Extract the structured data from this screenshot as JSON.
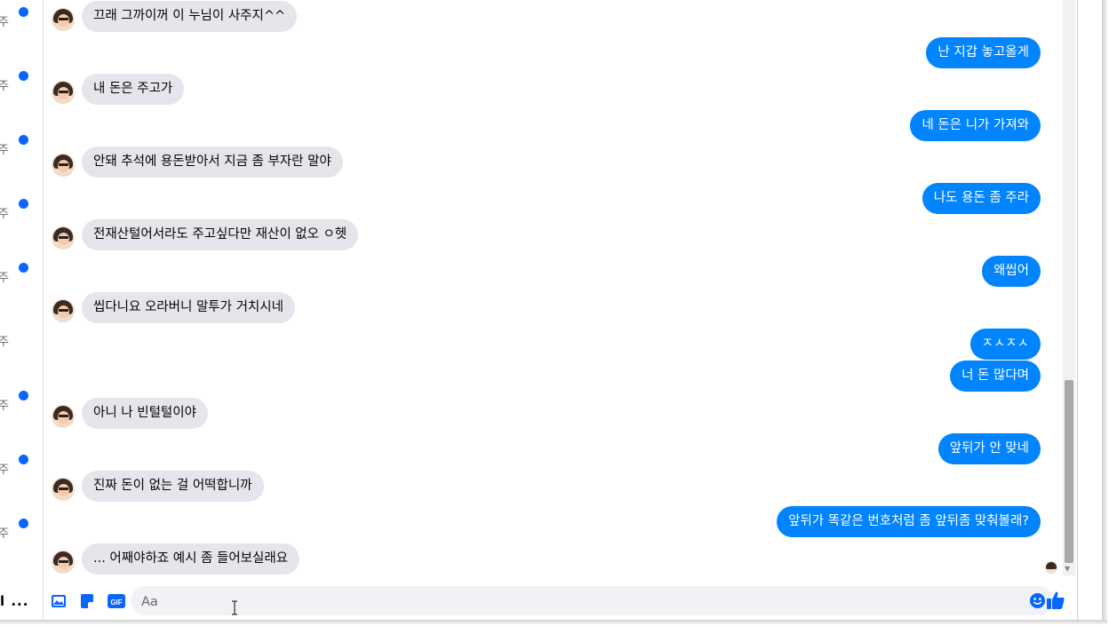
{
  "sidebar": {
    "snippets": [
      {
        "text": "주",
        "unread": true
      },
      {
        "text": "주",
        "unread": true
      },
      {
        "text": "주",
        "unread": true
      },
      {
        "text": "주",
        "unread": true
      },
      {
        "text": "주",
        "unread": true
      },
      {
        "text": "주",
        "unread": false
      },
      {
        "text": "주",
        "unread": true
      },
      {
        "text": "주",
        "unread": true
      },
      {
        "text": "주",
        "unread": true
      }
    ],
    "bottom_text": "l ..."
  },
  "messages": [
    {
      "from": "them",
      "text": "끄래 그까이꺼 이 누님이 사주지^^"
    },
    {
      "from": "me",
      "text": "난 지갑 놓고올게"
    },
    {
      "from": "them",
      "text": "내 돈은 주고가"
    },
    {
      "from": "me",
      "text": "네 돈은 니가 가져와"
    },
    {
      "from": "them",
      "text": "안돼 추석에 용돈받아서 지금 좀 부자란 말야"
    },
    {
      "from": "me",
      "text": "나도 용돈 좀 주라"
    },
    {
      "from": "them",
      "text": "전재산털어서라도 주고싶다만 재산이 없오 ㅇ헷"
    },
    {
      "from": "me",
      "text": "왜씹어"
    },
    {
      "from": "them",
      "text": "씹다니요 오라버니 말투가 거치시네"
    },
    {
      "from": "me",
      "text": "ㅈㅅㅈㅅ"
    },
    {
      "from": "me",
      "text": "너 돈 많다며"
    },
    {
      "from": "them",
      "text": "아니 나 빈털털이야"
    },
    {
      "from": "me",
      "text": "앞뒤가 안 맞네"
    },
    {
      "from": "them",
      "text": "진짜 돈이 없는 걸 어떡합니까"
    },
    {
      "from": "me",
      "text": "앞뒤가 똑같은 번호처럼 좀 앞뒤좀 맞춰볼래?"
    },
    {
      "from": "them",
      "text": "... 어째야하죠 예시 좀 들어보실래요"
    }
  ],
  "composer": {
    "placeholder": "Aa",
    "value": "",
    "gif_label": "GIF"
  },
  "colors": {
    "accent": "#0084ff",
    "incoming_bubble": "#e4e6eb",
    "unread_dot": "#0866ff"
  },
  "icons": [
    "photo-icon",
    "sticker-icon",
    "gif-icon",
    "emoji-icon",
    "thumbs-up-icon"
  ]
}
